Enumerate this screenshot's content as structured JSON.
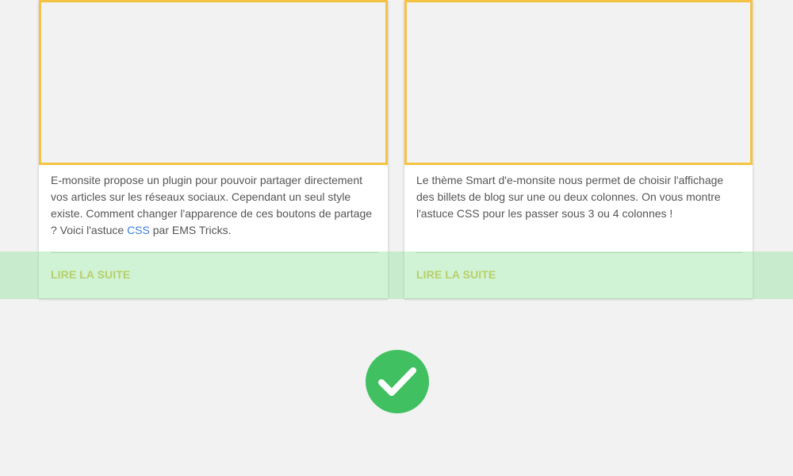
{
  "cards": [
    {
      "excerpt_before": "E-monsite propose un plugin pour pouvoir partager directement vos articles sur les réseaux sociaux. Cependant un seul style existe. Comment changer l'apparence de ces boutons de partage ? Voici l'astuce ",
      "excerpt_link": "CSS",
      "excerpt_after": " par EMS Tricks.",
      "read_more": "LIRE LA SUITE"
    },
    {
      "excerpt": "Le thème Smart d'e-monsite nous permet de choisir l'affichage des billets de blog sur une ou deux colonnes. On vous montre l'astuce CSS pour les passer sous 3 ou 4 colonnes !",
      "read_more": "LIRE LA SUITE"
    }
  ],
  "status_icon": {
    "name": "checkmark-circle-icon",
    "color": "#40c060"
  },
  "colors": {
    "thumbnail_border": "#f5c344",
    "read_more_text": "#d6c442",
    "highlight_band": "#90e09a",
    "link": "#3b7ddd",
    "background": "#f2f2f2"
  }
}
